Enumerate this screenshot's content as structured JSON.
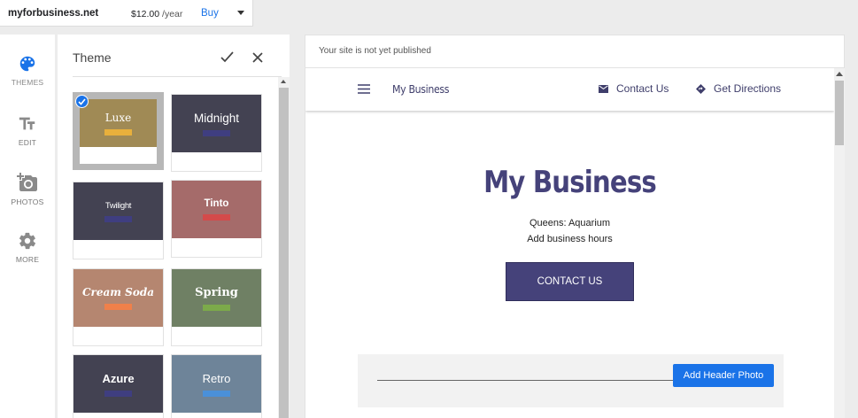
{
  "topbar": {
    "domain": "myforbusiness.net",
    "price": "$12.00",
    "period": "/year",
    "buy_label": "Buy"
  },
  "rail": {
    "items": [
      {
        "label": "THEMES",
        "icon": "palette-icon"
      },
      {
        "label": "EDIT",
        "icon": "text-format-icon"
      },
      {
        "label": "PHOTOS",
        "icon": "add-photo-icon"
      },
      {
        "label": "MORE",
        "icon": "gear-icon"
      }
    ]
  },
  "panel": {
    "title": "Theme",
    "themes": [
      {
        "name": "Luxe",
        "bg": "#a08a55",
        "accent": "#e8b03c",
        "selected": true
      },
      {
        "name": "Midnight",
        "bg": "#434252",
        "accent": "#3f3e80"
      },
      {
        "name": "Twilight",
        "bg": "#434252",
        "accent": "#3f3e80"
      },
      {
        "name": "Tinto",
        "bg": "#a56b6a",
        "accent": "#d44a4a"
      },
      {
        "name": "Cream Soda",
        "bg": "#b58670",
        "accent": "#f0804a"
      },
      {
        "name": "Spring",
        "bg": "#6f8064",
        "accent": "#7caa4a"
      },
      {
        "name": "Azure",
        "bg": "#434252",
        "accent": "#3f3e80"
      },
      {
        "name": "Retro",
        "bg": "#6e8499",
        "accent": "#4a90d9"
      }
    ]
  },
  "preview": {
    "status": "Your site is not yet published",
    "site": {
      "brand": "My Business",
      "nav_contact": "Contact Us",
      "nav_directions": "Get Directions",
      "hero_title": "My Business",
      "location": "Queens: Aquarium",
      "hours": "Add business hours",
      "cta_label": "CONTACT US",
      "add_header_photo_label": "Add Header Photo"
    }
  }
}
